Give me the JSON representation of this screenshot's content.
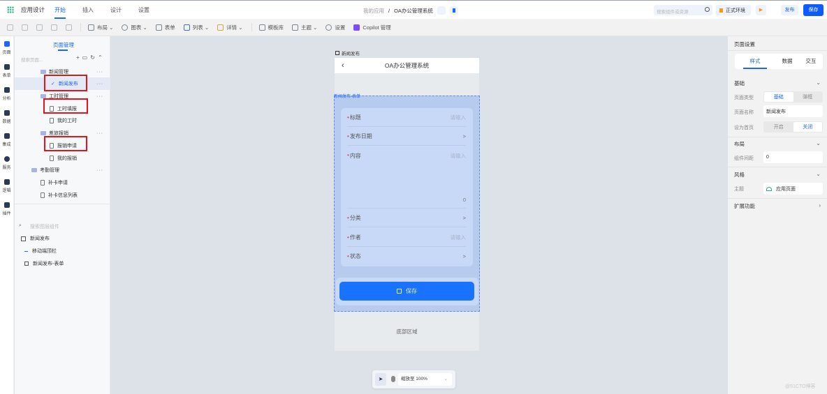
{
  "topbar": {
    "app_title": "应用设计",
    "tabs": [
      "开始",
      "插入",
      "设计",
      "设置"
    ],
    "breadcrumb_root": "我的应用",
    "breadcrumb_sep": "/",
    "app_name": "OA办公管理系统",
    "search_placeholder": "搜索组件或资源",
    "env_label": "正式环境",
    "publish_label": "发布",
    "save_label": "保存"
  },
  "toolbar": {
    "items": [
      "布局",
      "图表",
      "表单",
      "列表",
      "详情",
      "模板库",
      "主题",
      "设置",
      "Copilot 管理"
    ]
  },
  "rail": [
    "页面",
    "表单",
    "分析",
    "数据",
    "集成",
    "服务",
    "逻辑",
    "插件"
  ],
  "left": {
    "tab": "页面管理",
    "search_placeholder": "搜索页面...",
    "tree": [
      {
        "label": "新闻管理",
        "type": "folder"
      },
      {
        "label": "新闻发布",
        "type": "page"
      },
      {
        "label": "工时管理",
        "type": "folder"
      },
      {
        "label": "工时填报",
        "type": "page"
      },
      {
        "label": "我的工时",
        "type": "page"
      },
      {
        "label": "差旅报销",
        "type": "folder"
      },
      {
        "label": "报销申请",
        "type": "page"
      },
      {
        "label": "我的报销",
        "type": "page"
      },
      {
        "label": "考勤管理",
        "type": "folder"
      },
      {
        "label": "补卡申请",
        "type": "page"
      },
      {
        "label": "补卡信息列表",
        "type": "page"
      }
    ],
    "layer_search_placeholder": "搜索图层组件",
    "layers": [
      "新闻发布",
      "移动端顶栏",
      "新闻发布-表单"
    ]
  },
  "phone": {
    "page_label": "新闻发布",
    "title": "OA办公管理系统",
    "form_label": "新闻发布-表单",
    "fields": [
      {
        "label": "标题",
        "hint": "请输入"
      },
      {
        "label": "发布日期",
        "hint": ">"
      },
      {
        "label": "内容",
        "hint": "请输入"
      },
      {
        "label": "分类",
        "hint": ">"
      },
      {
        "label": "作者",
        "hint": "请输入"
      },
      {
        "label": "状态",
        "hint": ">"
      }
    ],
    "content_count": "0",
    "save_button": "保存",
    "footer": "底部区域"
  },
  "zoom": {
    "label": "缩放至 100%"
  },
  "right": {
    "title": "页面设置",
    "tabs": [
      "样式",
      "数据",
      "交互"
    ],
    "basic": "基础",
    "page_type_label": "页面类型",
    "page_type_options": [
      "基础",
      "弹框"
    ],
    "page_name_label": "页面名称",
    "page_name": "新闻发布",
    "home_label": "设为首页",
    "home_options": [
      "开启",
      "关闭"
    ],
    "layout": "布局",
    "gap_label": "组件间距",
    "gap_value": "0",
    "style": "风格",
    "theme_label": "主题",
    "theme_value": "应用页面",
    "extend": "扩展功能"
  },
  "watermark": "@51CTO博客"
}
